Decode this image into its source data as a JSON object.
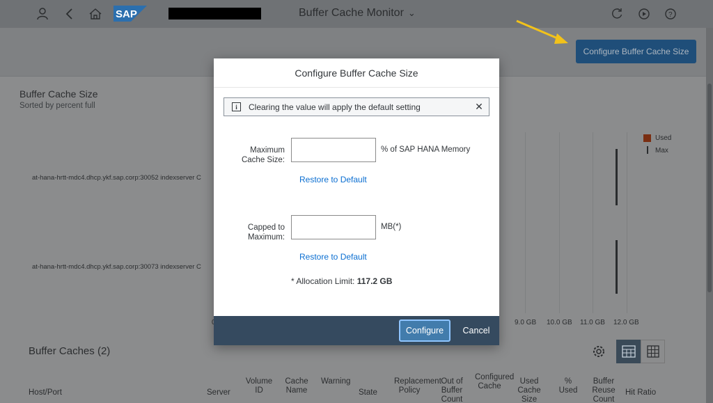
{
  "header": {
    "title": "Buffer Cache Monitor",
    "logo_text": "SAP",
    "icons": [
      "user-icon",
      "back-icon",
      "home-icon",
      "refresh-icon",
      "play-icon",
      "help-icon"
    ]
  },
  "toolbar": {
    "configure_label": "Configure Buffer Cache Size"
  },
  "chart": {
    "title": "Buffer Cache Size",
    "subtitle": "Sorted by percent full",
    "hosts": [
      "at-hana-hrtt-mdc4.dhcp.ykf.sap.corp:30052 indexserver C",
      "at-hana-hrtt-mdc4.dhcp.ykf.sap.corp:30073 indexserver C"
    ],
    "partial_tick": "0",
    "legend": {
      "used": "Used",
      "max": "Max",
      "used_color": "#7a2e12"
    }
  },
  "chart_data": {
    "type": "bar",
    "title": "Buffer Cache Size",
    "subtitle": "Sorted by percent full",
    "categories": [
      "at-hana-hrtt-mdc4.dhcp.ykf.sap.corp:30052 indexserver C",
      "at-hana-hrtt-mdc4.dhcp.ykf.sap.corp:30073 indexserver C"
    ],
    "series": [
      {
        "name": "Used",
        "values": [
          0,
          0
        ]
      },
      {
        "name": "Max",
        "values": [
          11.7,
          11.7
        ]
      }
    ],
    "x_ticks": [
      "9.0 GB",
      "10.0 GB",
      "11.0 GB",
      "12.0 GB"
    ],
    "legend_position": "top-right"
  },
  "table": {
    "title": "Buffer Caches (2)",
    "columns": [
      "Host/Port",
      "Server",
      "Volume ID",
      "Cache Name",
      "Warning",
      "State",
      "Replacement Policy",
      "Out of Buffer Count",
      "Configured Cache",
      "Used Cache Size",
      "% Used",
      "Buffer Reuse Count",
      "Hit Ratio"
    ]
  },
  "dialog": {
    "title": "Configure Buffer Cache Size",
    "info_message": "Clearing the value will apply the default setting",
    "max_cache_label": "Maximum Cache Size:",
    "max_cache_value": "",
    "max_cache_unit": "% of SAP HANA Memory",
    "restore_label": "Restore to Default",
    "capped_label": "Capped to Maximum:",
    "capped_value": "",
    "capped_unit": "MB(*)",
    "alloc_prefix": "* Allocation Limit: ",
    "alloc_value": "117.2 GB",
    "configure_label": "Configure",
    "cancel_label": "Cancel"
  }
}
